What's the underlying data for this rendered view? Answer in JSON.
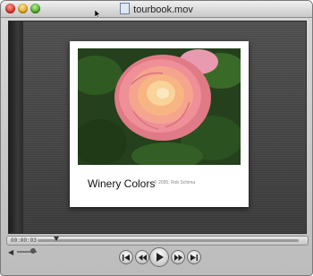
{
  "window": {
    "title": "tourbook.mov"
  },
  "card": {
    "title": "Winery Colors",
    "credit": "© 2005, Rob Schima"
  },
  "player": {
    "timecode": "00:00:03"
  },
  "icons": {
    "close": "close-icon",
    "minimize": "minimize-icon",
    "zoom": "zoom-icon",
    "document": "movie-document-icon",
    "volume": "speaker-icon",
    "skip_back": "skip-to-start-icon",
    "rewind": "rewind-icon",
    "play": "play-icon",
    "fast_forward": "fast-forward-icon",
    "skip_forward": "skip-to-end-icon"
  }
}
